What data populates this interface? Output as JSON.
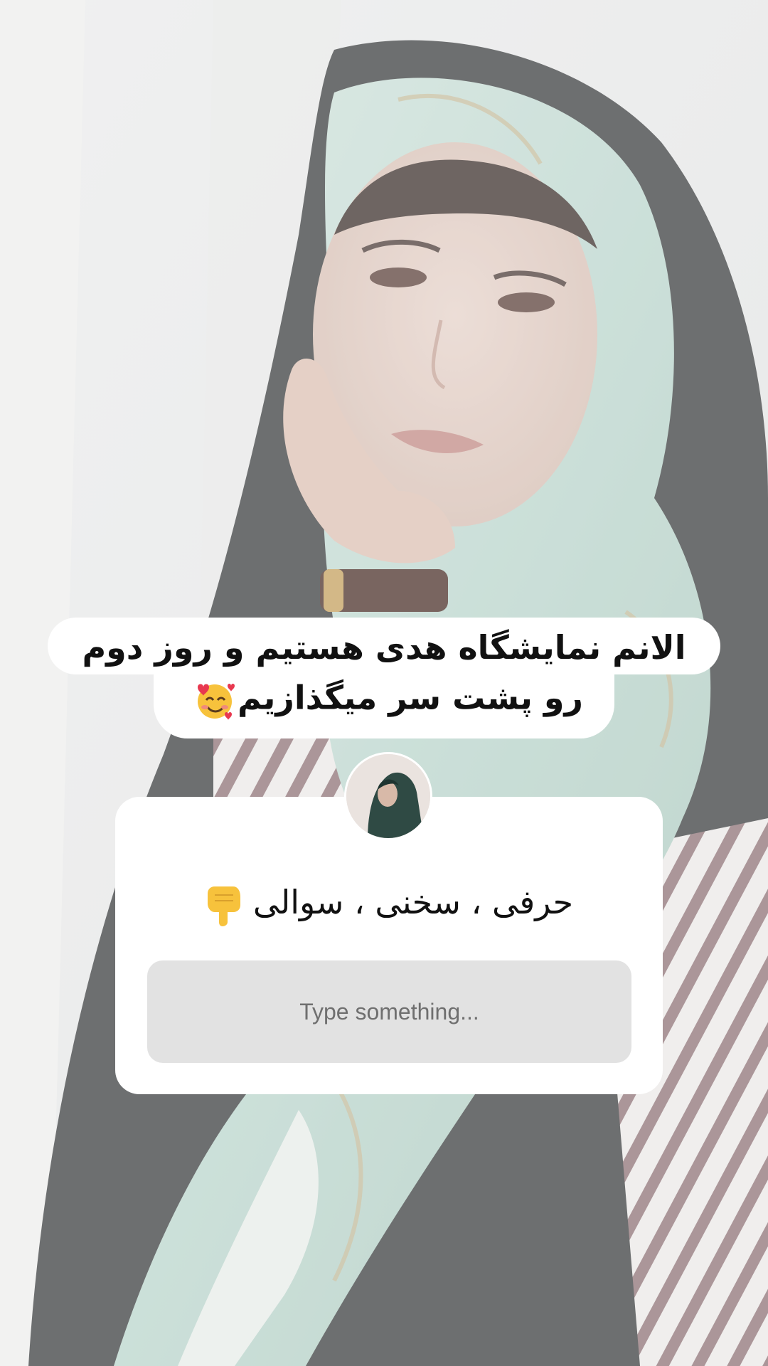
{
  "caption": {
    "line1": "الانم نمایشگاه هدی هستیم و روز دوم",
    "line2": "رو پشت سر میگذازیم",
    "emoji": "smiling-face-with-hearts"
  },
  "question": {
    "prompt": "حرفی ، سخنی ، سوالی",
    "prompt_emoji": "backhand-index-pointing-down",
    "input_placeholder": "Type something..."
  }
}
